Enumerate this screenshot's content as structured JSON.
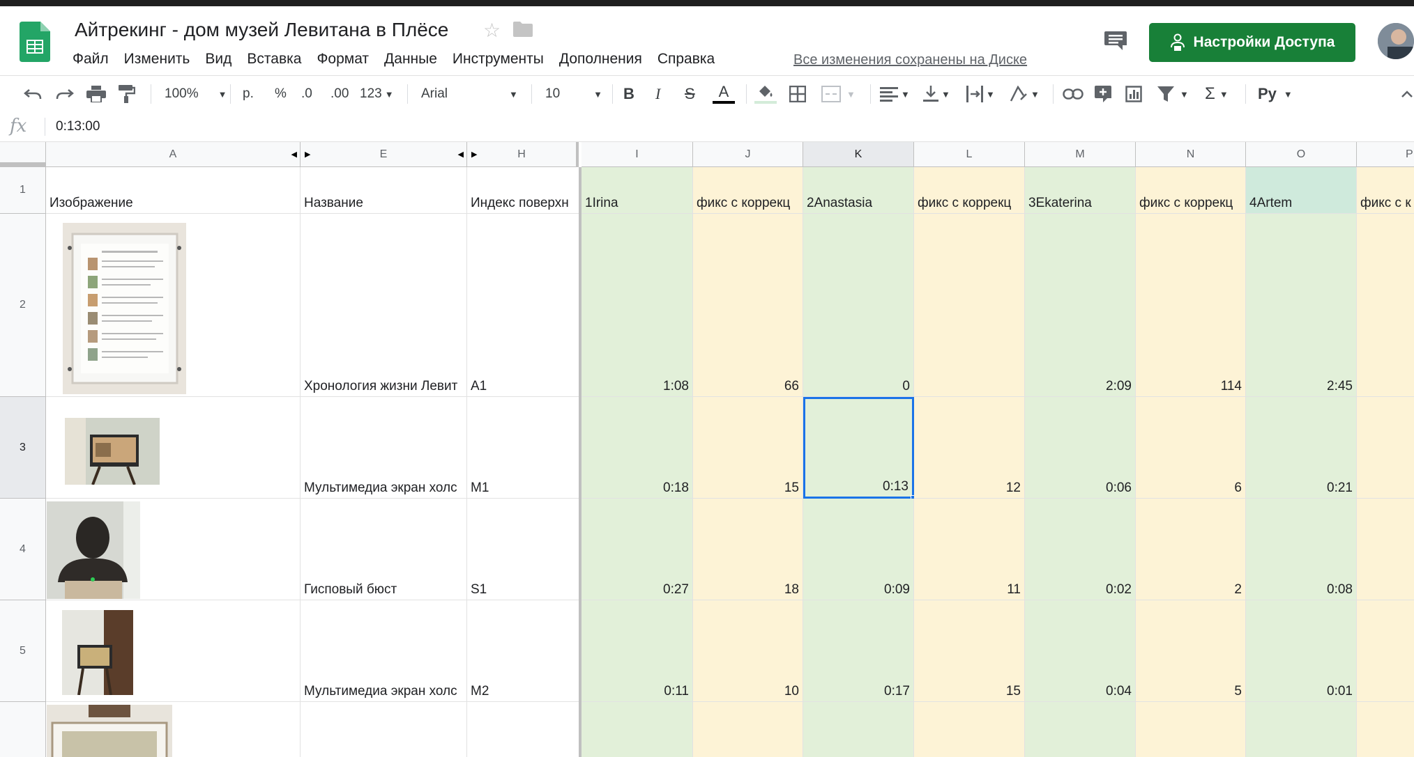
{
  "doc": {
    "title": "Айтрекинг - дом музей Левитана в Плёсе",
    "saved_status": "Все изменения сохранены на Диске",
    "share_label": "Настройки Доступа"
  },
  "menu": [
    "Файл",
    "Изменить",
    "Вид",
    "Вставка",
    "Формат",
    "Данные",
    "Инструменты",
    "Дополнения",
    "Справка"
  ],
  "toolbar": {
    "zoom": "100%",
    "currency": "р.",
    "percent": "%",
    "dec_decrease": ".0",
    "dec_increase": ".00",
    "format_more": "123",
    "font": "Arial",
    "font_size": "10",
    "bold": "B",
    "italic": "I",
    "strike": "S",
    "text_color": "A",
    "sum": "Σ",
    "input_tools": "Pу"
  },
  "formula_bar": {
    "fx": "fx",
    "value": "0:13:00"
  },
  "columns": [
    "A",
    "E",
    "H",
    "I",
    "J",
    "K",
    "L",
    "M",
    "N",
    "O",
    "P"
  ],
  "header_row": [
    "Изображение",
    "Название",
    "Индекс поверхн",
    "1Irina",
    "фикс с коррекц",
    "2Anastasia",
    "фикс с коррекц",
    "3Ekaterina",
    "фикс с коррекц",
    "4Artem",
    "фикс с к"
  ],
  "row_numbers": [
    "1",
    "2",
    "3",
    "4",
    "5"
  ],
  "rows": [
    {
      "name": "Хронология жизни Левит",
      "index": "A1",
      "I": "1:08",
      "J": "66",
      "K": "0",
      "L": "",
      "M": "2:09",
      "N": "114",
      "O": "2:45"
    },
    {
      "name": "Мультимедиа экран холс",
      "index": "M1",
      "I": "0:18",
      "J": "15",
      "K": "0:13",
      "L": "12",
      "M": "0:06",
      "N": "6",
      "O": "0:21"
    },
    {
      "name": "Гисповый бюст",
      "index": "S1",
      "I": "0:27",
      "J": "18",
      "K": "0:09",
      "L": "11",
      "M": "0:02",
      "N": "2",
      "O": "0:08"
    },
    {
      "name": "Мультимедиа экран холс",
      "index": "M2",
      "I": "0:11",
      "J": "10",
      "K": "0:17",
      "L": "15",
      "M": "0:04",
      "N": "5",
      "O": "0:01"
    }
  ],
  "colors": {
    "share_green": "#188038",
    "col_green": "#e2f0d9",
    "col_yellow": "#fdf3d6",
    "selected_header": "#cfeadc",
    "selection_border": "#1a73e8"
  }
}
